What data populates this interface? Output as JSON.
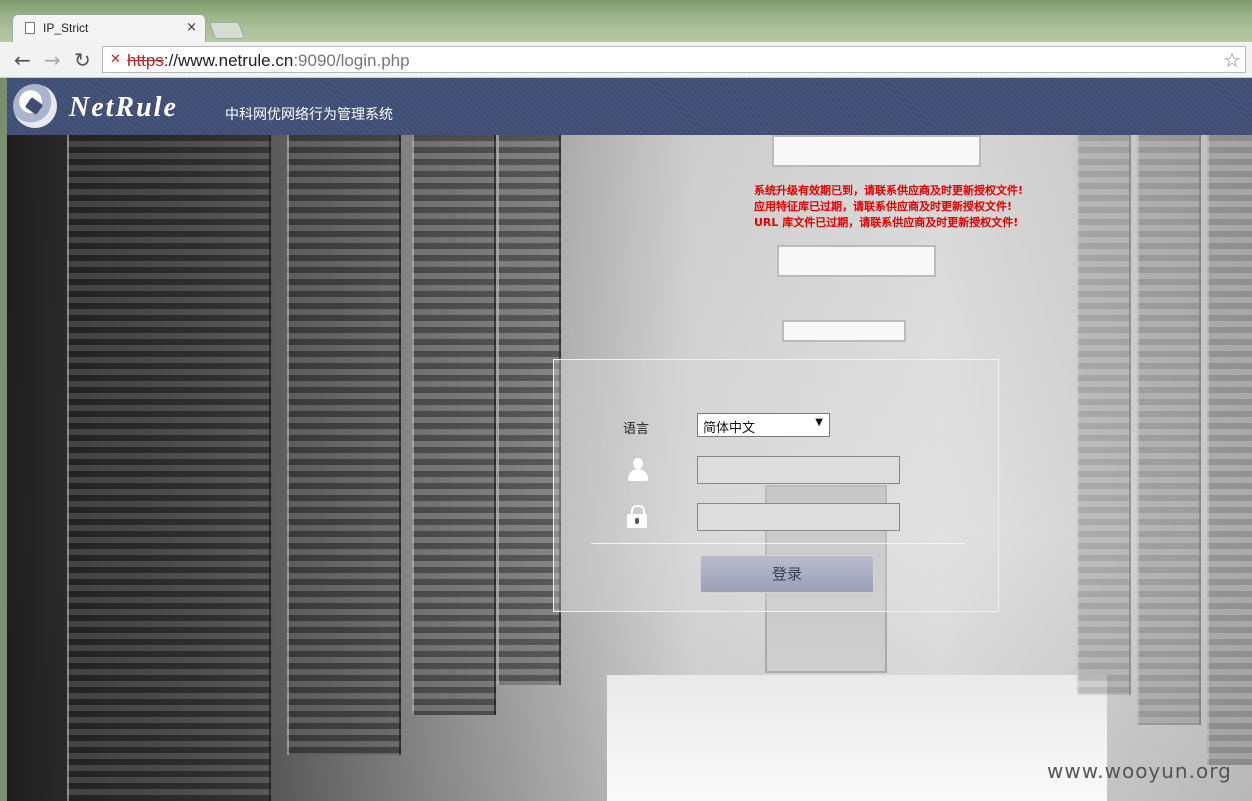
{
  "browser": {
    "tab_title": "IP_Strict",
    "tab_close": "×",
    "url_scheme": "https",
    "url_host": "://www.netrule.cn",
    "url_path": ":9090/login.php"
  },
  "header": {
    "brand": "NetRule",
    "system_title": "中科网优网络行为管理系统"
  },
  "warnings": [
    "系统升级有效期已到，请联系供应商及时更新授权文件!",
    "应用特征库已过期，请联系供应商及时更新授权文件!",
    "URL 库文件已过期，请联系供应商及时更新授权文件!"
  ],
  "login": {
    "language_label": "语言",
    "language_selected": "简体中文",
    "username_value": "",
    "password_value": "",
    "submit_label": "登录"
  },
  "watermark": "www.wooyun.org",
  "colors": {
    "header_bg": "#43527a",
    "warning_text": "#e00000",
    "button_bg": "#a6abbf"
  }
}
